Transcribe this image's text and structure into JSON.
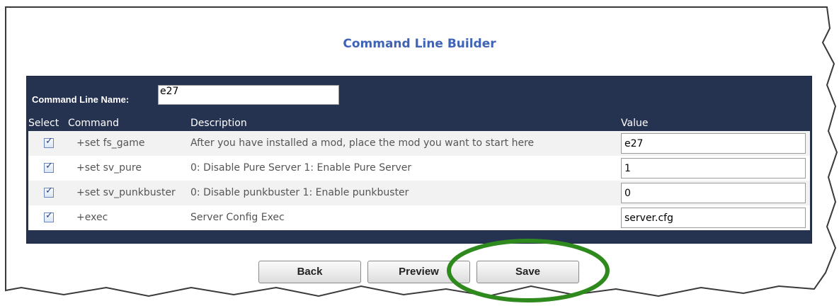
{
  "page": {
    "title": "Command Line Builder"
  },
  "form": {
    "name_label": "Command Line Name:",
    "name_value": "e27"
  },
  "table": {
    "headers": [
      "Select",
      "Command",
      "Description",
      "Value"
    ],
    "rows": [
      {
        "checked": true,
        "command": "+set fs_game",
        "description": "After you have installed a mod, place the mod you want to start here",
        "value": "e27"
      },
      {
        "checked": true,
        "command": "+set sv_pure",
        "description": "0: Disable Pure Server 1: Enable Pure Server",
        "value": "1"
      },
      {
        "checked": true,
        "command": "+set sv_punkbuster",
        "description": "0: Disable punkbuster 1: Enable punkbuster",
        "value": "0"
      },
      {
        "checked": true,
        "command": "+exec",
        "description": "Server Config Exec",
        "value": "server.cfg"
      }
    ]
  },
  "buttons": {
    "back": "Back",
    "preview": "Preview",
    "save": "Save"
  },
  "colors": {
    "title": "#3f63b5",
    "panel": "#263350",
    "highlight_ring": "#2f8a1d"
  }
}
